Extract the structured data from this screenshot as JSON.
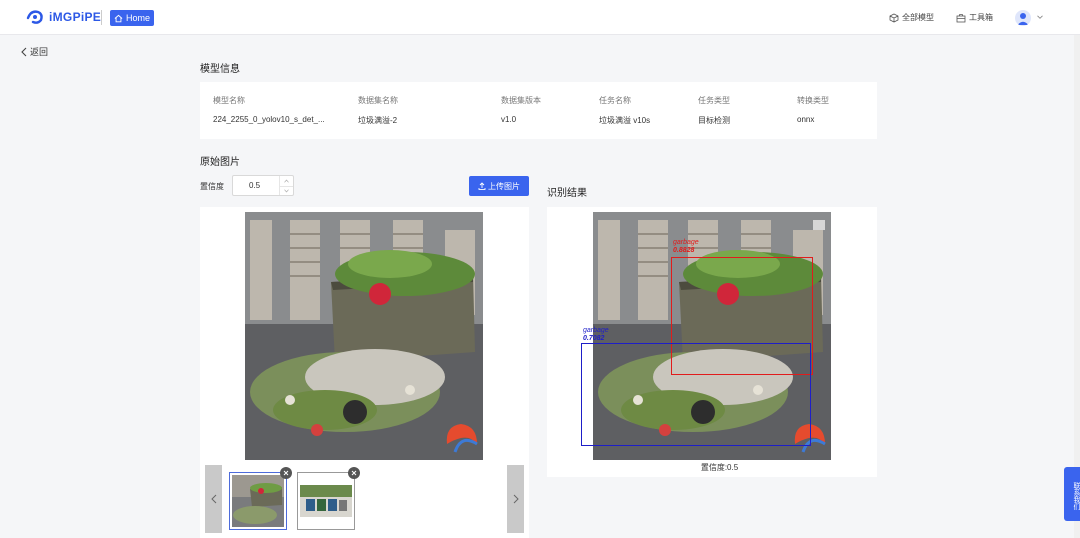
{
  "header": {
    "logo_text": "iMGPiPE",
    "home_label": "Home",
    "nav_all_models": "全部模型",
    "nav_toolbox": "工具箱"
  },
  "back_label": "返回",
  "model_info": {
    "title": "模型信息",
    "columns": [
      {
        "label": "模型名称",
        "value": "224_2255_0_yolov10_s_det_..."
      },
      {
        "label": "数据集名称",
        "value": "垃圾满溢-2"
      },
      {
        "label": "数据集版本",
        "value": "v1.0"
      },
      {
        "label": "任务名称",
        "value": "垃圾满溢 v10s"
      },
      {
        "label": "任务类型",
        "value": "目标检测"
      },
      {
        "label": "转换类型",
        "value": "onnx"
      }
    ]
  },
  "original": {
    "title": "原始图片",
    "confidence_label": "置信度",
    "confidence_value": "0.5",
    "upload_label": "上传图片"
  },
  "result": {
    "title": "识别结果",
    "caption": "置信度:0.5",
    "detections": [
      {
        "label": "garbage",
        "score": "0.8828",
        "color": "#e11c1c"
      },
      {
        "label": "garbage",
        "score": "0.7082",
        "color": "#1e1ec8"
      }
    ]
  },
  "contact_label": "联系我们",
  "colors": {
    "accent": "#3a64ee",
    "background": "#f5f6f8"
  }
}
